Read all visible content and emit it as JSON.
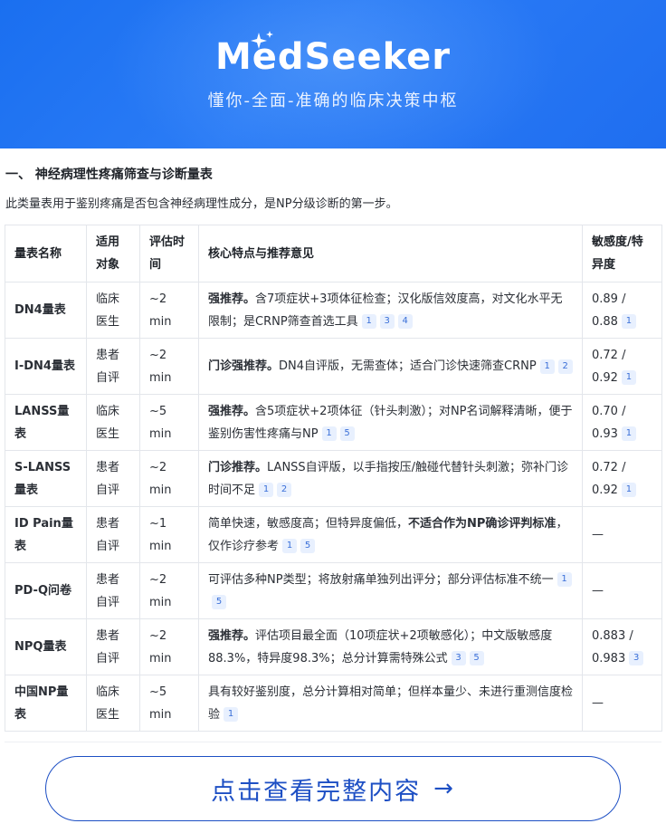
{
  "header": {
    "brand": "MedSeeker",
    "tagline": "懂你-全面-准确的临床决策中枢"
  },
  "section": {
    "title": "一、 神经病理性疼痛筛查与诊断量表",
    "description": "此类量表用于鉴别疼痛是否包含神经病理性成分，是NP分级诊断的第一步。"
  },
  "table": {
    "headers": {
      "name": "量表名称",
      "audience": "适用对象",
      "time": "评估时间",
      "features": "核心特点与推荐意见",
      "accuracy": "敏感度/特异度"
    },
    "rows": [
      {
        "name": "DN4量表",
        "audience": "临床医生",
        "time": "~2 min",
        "strong": "强推荐。",
        "text": "含7项症状+3项体征检查；汉化版信效度高，对文化水平无限制；是CRNP筛查首选工具",
        "refs": [
          "1",
          "3",
          "4"
        ],
        "accuracy": "0.89 / 0.88",
        "accuracy_refs": [
          "1"
        ]
      },
      {
        "name": "I-DN4量表",
        "audience": "患者自评",
        "time": "~2 min",
        "strong": "门诊强推荐。",
        "text": "DN4自评版，无需查体；适合门诊快速筛查CRNP",
        "refs": [
          "1",
          "2"
        ],
        "accuracy": "0.72 / 0.92",
        "accuracy_refs": [
          "1"
        ]
      },
      {
        "name": "LANSS量表",
        "audience": "临床医生",
        "time": "~5 min",
        "strong": "强推荐。",
        "text": "含5项症状+2项体征（针头刺激）；对NP名词解释清晰，便于鉴别伤害性疼痛与NP",
        "refs": [
          "1",
          "5"
        ],
        "accuracy": "0.70 / 0.93",
        "accuracy_refs": [
          "1"
        ]
      },
      {
        "name": "S-LANSS量表",
        "audience": "患者自评",
        "time": "~2 min",
        "strong": "门诊推荐。",
        "text": "LANSS自评版，以手指按压/触碰代替针头刺激；弥补门诊时间不足",
        "refs": [
          "1",
          "2"
        ],
        "accuracy": "0.72 / 0.92",
        "accuracy_refs": [
          "1"
        ]
      },
      {
        "name": "ID Pain量表",
        "audience": "患者自评",
        "time": "~1 min",
        "pre": "简单快速，敏感度高；但特异度偏低，",
        "strong_mid": "不适合作为NP确诊评判标准",
        "post": "，仅作诊疗参考",
        "refs": [
          "1",
          "5"
        ],
        "accuracy": "—"
      },
      {
        "name": "PD-Q问卷",
        "audience": "患者自评",
        "time": "~2 min",
        "text": "可评估多种NP类型；将放射痛单独列出评分；部分评估标准不统一",
        "refs": [
          "1",
          "5"
        ],
        "accuracy": "—"
      },
      {
        "name": "NPQ量表",
        "audience": "患者自评",
        "time": "~2 min",
        "strong": "强推荐。",
        "text": "评估项目最全面（10项症状+2项敏感化）；中文版敏感度88.3%，特异度98.3%；总分计算需特殊公式",
        "refs": [
          "3",
          "5"
        ],
        "accuracy": "0.883 / 0.983",
        "accuracy_refs": [
          "3"
        ]
      },
      {
        "name": "中国NP量表",
        "audience": "临床医生",
        "time": "~5 min",
        "text": "具有较好鉴别度，总分计算相对简单；但样本量少、未进行重测信度检验",
        "refs": [
          "1"
        ],
        "accuracy": "—"
      }
    ]
  },
  "cta": {
    "label": "点击查看完整内容",
    "icon": "arrow-right-icon"
  },
  "colors": {
    "banner": "#2b7cf6",
    "accent": "#1d4fc4",
    "ref_badge_bg": "#e8f0fe",
    "ref_badge_text": "#3a6fd8"
  }
}
